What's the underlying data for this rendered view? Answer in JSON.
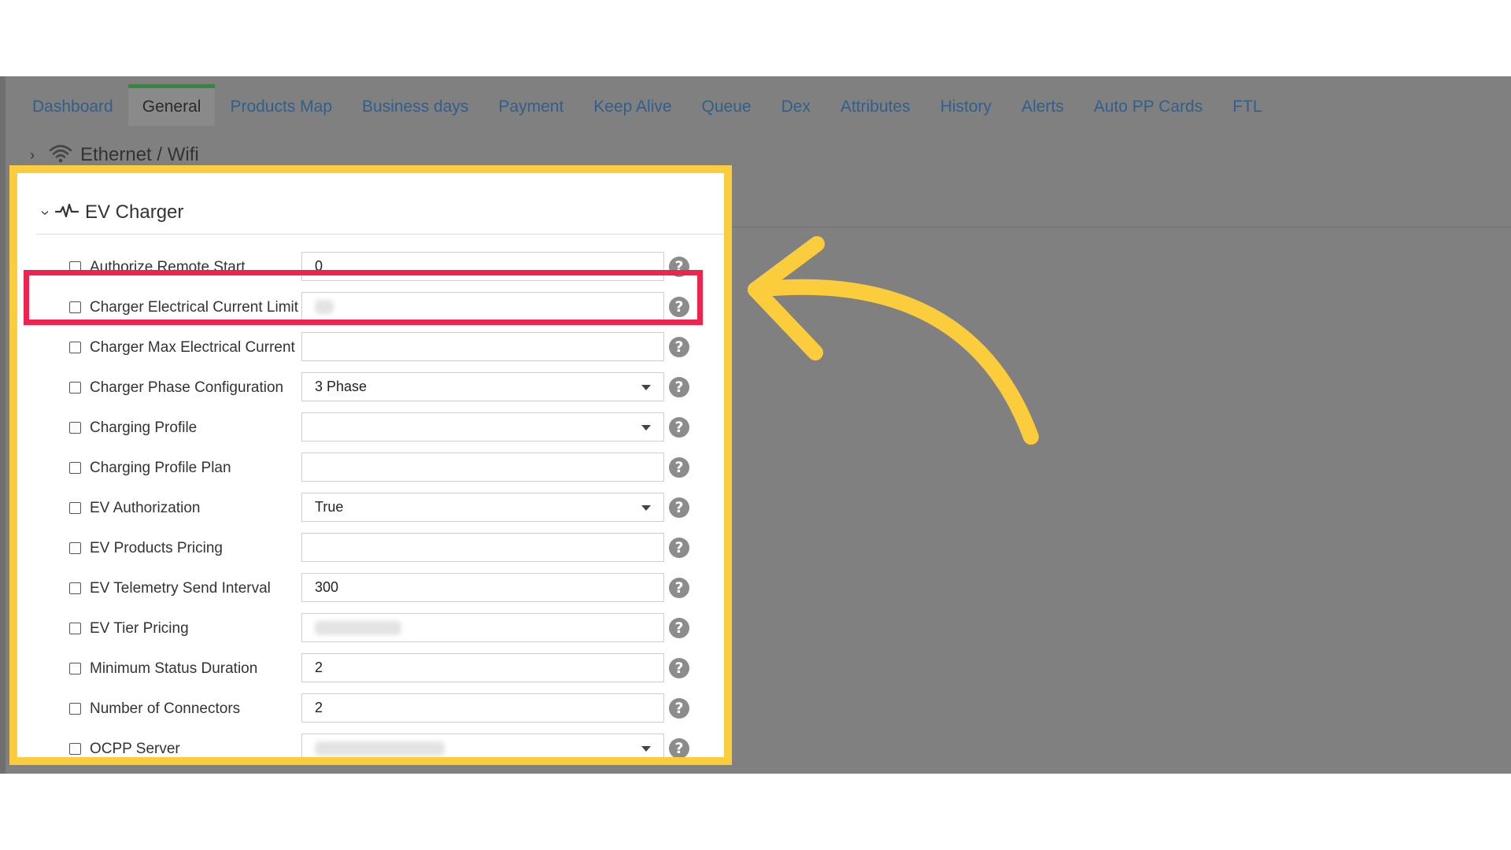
{
  "tabs": [
    {
      "label": "Dashboard",
      "active": false
    },
    {
      "label": "General",
      "active": true
    },
    {
      "label": "Products Map",
      "active": false
    },
    {
      "label": "Business days",
      "active": false
    },
    {
      "label": "Payment",
      "active": false
    },
    {
      "label": "Keep Alive",
      "active": false
    },
    {
      "label": "Queue",
      "active": false
    },
    {
      "label": "Dex",
      "active": false
    },
    {
      "label": "Attributes",
      "active": false
    },
    {
      "label": "History",
      "active": false
    },
    {
      "label": "Alerts",
      "active": false
    },
    {
      "label": "Auto PP Cards",
      "active": false
    },
    {
      "label": "FTL",
      "active": false
    }
  ],
  "sections": {
    "ethernet": {
      "title": "Ethernet / Wifi",
      "icon": "wifi-icon",
      "expanded": false
    },
    "ev_charger": {
      "title": "EV Charger",
      "icon": "pulse-icon",
      "expanded": true
    }
  },
  "fields": [
    {
      "label": "Authorize Remote Start",
      "value": "0",
      "type": "text",
      "checked": false
    },
    {
      "label": "Charger Electrical Current Limit",
      "value": "",
      "type": "text",
      "checked": false,
      "redacted": true,
      "highlighted": true
    },
    {
      "label": "Charger Max Electrical Current",
      "value": "",
      "type": "text",
      "checked": false
    },
    {
      "label": "Charger Phase Configuration",
      "value": "3 Phase",
      "type": "select",
      "checked": false
    },
    {
      "label": "Charging Profile",
      "value": "",
      "type": "select",
      "checked": false
    },
    {
      "label": "Charging Profile Plan",
      "value": "",
      "type": "text",
      "checked": false
    },
    {
      "label": "EV Authorization",
      "value": "True",
      "type": "select",
      "checked": false
    },
    {
      "label": "EV Products Pricing",
      "value": "",
      "type": "text",
      "checked": false
    },
    {
      "label": "EV Telemetry Send Interval",
      "value": "300",
      "type": "text",
      "checked": false
    },
    {
      "label": "EV Tier Pricing",
      "value": "",
      "type": "text",
      "checked": false,
      "redacted": true
    },
    {
      "label": "Minimum Status Duration",
      "value": "2",
      "type": "text",
      "checked": false
    },
    {
      "label": "Number of Connectors",
      "value": "2",
      "type": "text",
      "checked": false
    },
    {
      "label": "OCPP Server",
      "value": "",
      "type": "select",
      "checked": false,
      "redacted": true
    }
  ],
  "help_icon": "question-circle-icon",
  "colors": {
    "highlight_yellow": "#fbcd3d",
    "highlight_red": "#f0224e",
    "active_tab_accent": "#2e8b3a",
    "tab_text": "#2f5f8e"
  }
}
